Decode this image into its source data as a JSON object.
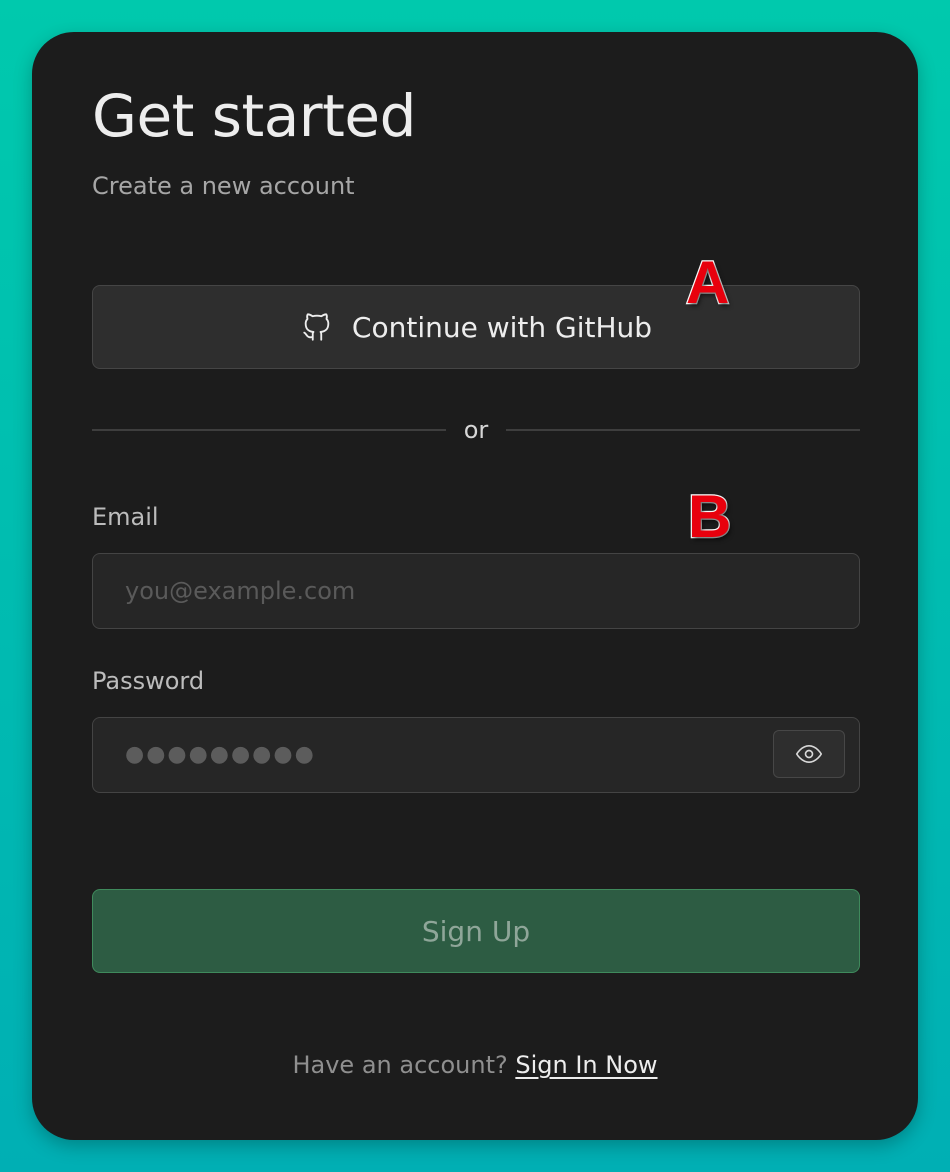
{
  "header": {
    "title": "Get started",
    "subtitle": "Create a new account"
  },
  "oauth": {
    "github_label": "Continue with GitHub",
    "icon": "github-icon"
  },
  "divider": {
    "text": "or"
  },
  "form": {
    "email_label": "Email",
    "email_placeholder": "you@example.com",
    "email_value": "",
    "password_label": "Password",
    "password_masked": "●●●●●●●●●",
    "reveal_icon": "eye-icon",
    "submit_label": "Sign Up"
  },
  "footer": {
    "prompt": "Have an account?",
    "link": "Sign In Now"
  },
  "markers": {
    "a": "A",
    "b": "B"
  },
  "colors": {
    "background_gradient_top": "#00c9ad",
    "background_gradient_bottom": "#00afb4",
    "card": "#1c1c1c",
    "primary_button": "#2d5c43",
    "marker": "#e8000d"
  }
}
